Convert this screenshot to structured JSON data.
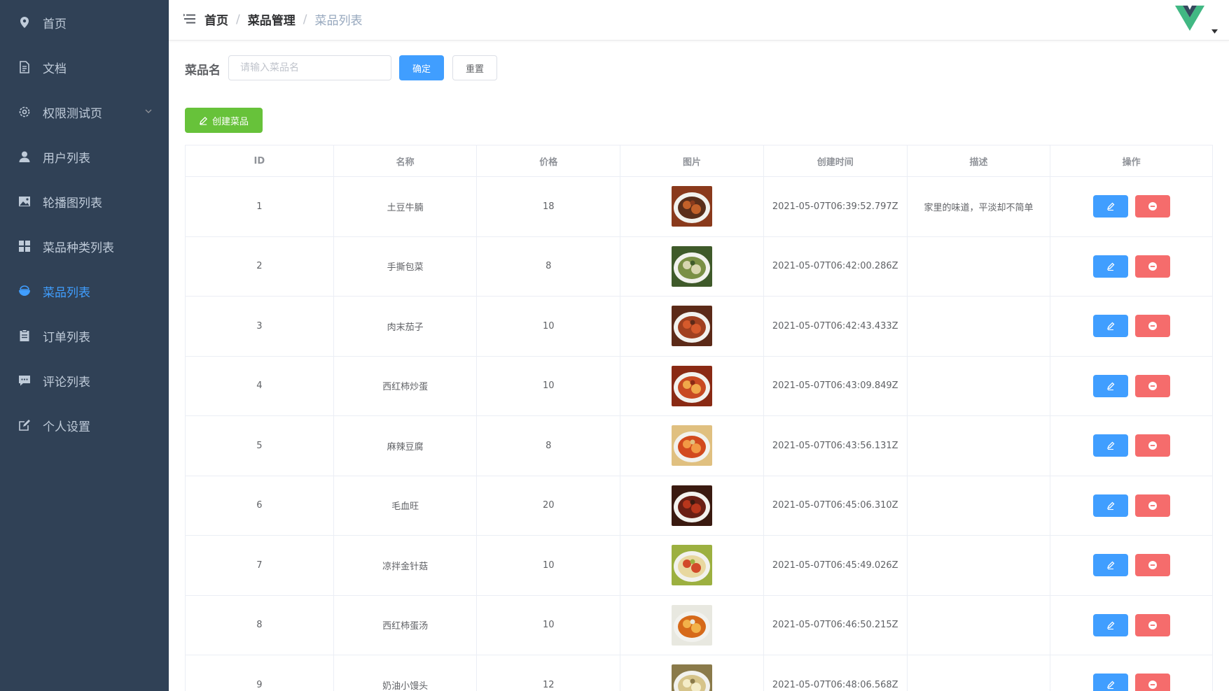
{
  "sidebar": {
    "items": [
      {
        "label": "首页",
        "icon": "location-icon"
      },
      {
        "label": "文档",
        "icon": "document-icon"
      },
      {
        "label": "权限测试页",
        "icon": "gear-icon",
        "has_submenu": true
      },
      {
        "label": "用户列表",
        "icon": "user-icon"
      },
      {
        "label": "轮播图列表",
        "icon": "picture-icon"
      },
      {
        "label": "菜品种类列表",
        "icon": "grid-icon"
      },
      {
        "label": "菜品列表",
        "icon": "bowl-icon",
        "active": true
      },
      {
        "label": "订单列表",
        "icon": "clipboard-icon"
      },
      {
        "label": "评论列表",
        "icon": "comment-icon"
      },
      {
        "label": "个人设置",
        "icon": "edit-icon"
      }
    ]
  },
  "breadcrumb": {
    "items": [
      "首页",
      "菜品管理",
      "菜品列表"
    ],
    "separator": "/"
  },
  "filter": {
    "label": "菜品名",
    "value": "",
    "placeholder": "请输入菜品名",
    "confirm_label": "确定",
    "reset_label": "重置"
  },
  "toolbar": {
    "create_label": "创建菜品"
  },
  "table": {
    "columns": [
      "ID",
      "名称",
      "价格",
      "图片",
      "创建时间",
      "描述",
      "操作"
    ],
    "rows": [
      {
        "id": "1",
        "name": "土豆牛腩",
        "price": "18",
        "created": "2021-05-07T06:39:52.797Z",
        "desc": "家里的味道，平淡却不简单"
      },
      {
        "id": "2",
        "name": "手撕包菜",
        "price": "8",
        "created": "2021-05-07T06:42:00.286Z",
        "desc": ""
      },
      {
        "id": "3",
        "name": "肉末茄子",
        "price": "10",
        "created": "2021-05-07T06:42:43.433Z",
        "desc": ""
      },
      {
        "id": "4",
        "name": "西红柿炒蛋",
        "price": "10",
        "created": "2021-05-07T06:43:09.849Z",
        "desc": ""
      },
      {
        "id": "5",
        "name": "麻辣豆腐",
        "price": "8",
        "created": "2021-05-07T06:43:56.131Z",
        "desc": ""
      },
      {
        "id": "6",
        "name": "毛血旺",
        "price": "20",
        "created": "2021-05-07T06:45:06.310Z",
        "desc": ""
      },
      {
        "id": "7",
        "name": "凉拌金针菇",
        "price": "10",
        "created": "2021-05-07T06:45:49.026Z",
        "desc": ""
      },
      {
        "id": "8",
        "name": "西红柿蛋汤",
        "price": "10",
        "created": "2021-05-07T06:46:50.215Z",
        "desc": ""
      },
      {
        "id": "9",
        "name": "奶油小馒头",
        "price": "12",
        "created": "2021-05-07T06:48:06.568Z",
        "desc": ""
      }
    ]
  },
  "colors": {
    "sidebar_bg": "#304156",
    "sidebar_text": "#bfcbd9",
    "active": "#409eff",
    "primary": "#409eff",
    "success": "#67c23a",
    "danger": "#f56c6c"
  }
}
